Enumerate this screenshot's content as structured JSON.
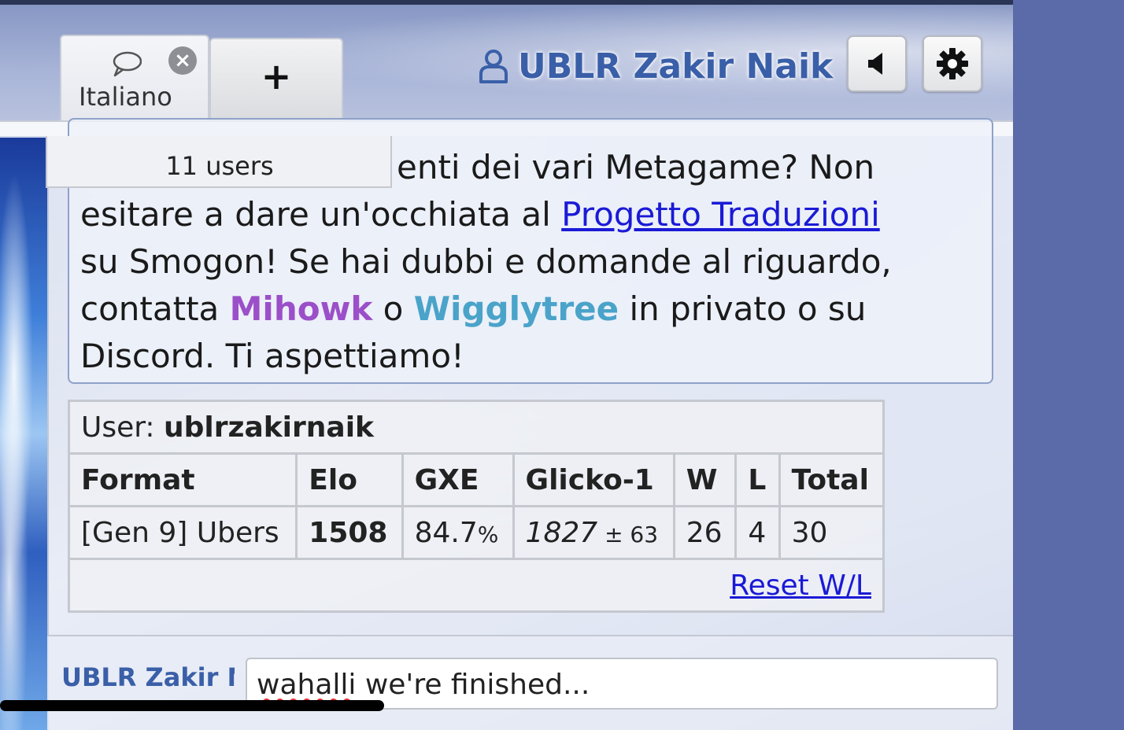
{
  "tabs": {
    "active": {
      "label": "Italiano",
      "icon": "chat-bubble-icon",
      "close_icon": "close-icon"
    },
    "add": {
      "label": "+"
    }
  },
  "header": {
    "username": "UBLR Zakir Naik",
    "user_icon": "user-icon",
    "sound_icon": "speaker-icon",
    "settings_icon": "gear-icon"
  },
  "room": {
    "users_count": "11 users",
    "announcement": {
      "line1_tail": "enti dei vari Metagame? Non",
      "line2_pre": "esitare a dare un'occhiata al ",
      "link": "Progetto Traduzioni",
      "line3": "su Smogon! Se hai dubbi e domande al riguardo,",
      "line4_pre": "contatta ",
      "name1": "Mihowk",
      "mid": " o ",
      "name2": "Wigglytree",
      "line4_post": " in privato o su",
      "line5": "Discord. Ti aspettiamo!"
    }
  },
  "ladder": {
    "user_label": "User: ",
    "user_value": "ublrzakirnaik",
    "headers": [
      "Format",
      "Elo",
      "GXE",
      "Glicko-1",
      "W",
      "L",
      "Total"
    ],
    "row": {
      "format": "[Gen 9] Ubers",
      "elo": "1508",
      "gxe_main": "84.7",
      "gxe_unit": "%",
      "glicko": "1827",
      "glicko_dev": " ± 63",
      "w": "26",
      "l": "4",
      "total": "30"
    },
    "reset_label": "Reset W/L"
  },
  "chat": {
    "user": "UBLR Zakir Naik",
    "input_word1": "wahalli",
    "input_rest": " we're finished..."
  },
  "colors": {
    "username": "#3a5fa8",
    "link": "#1a1ad6",
    "mihowk": "#9b4fc8",
    "wigglytree": "#4aa3c9"
  }
}
